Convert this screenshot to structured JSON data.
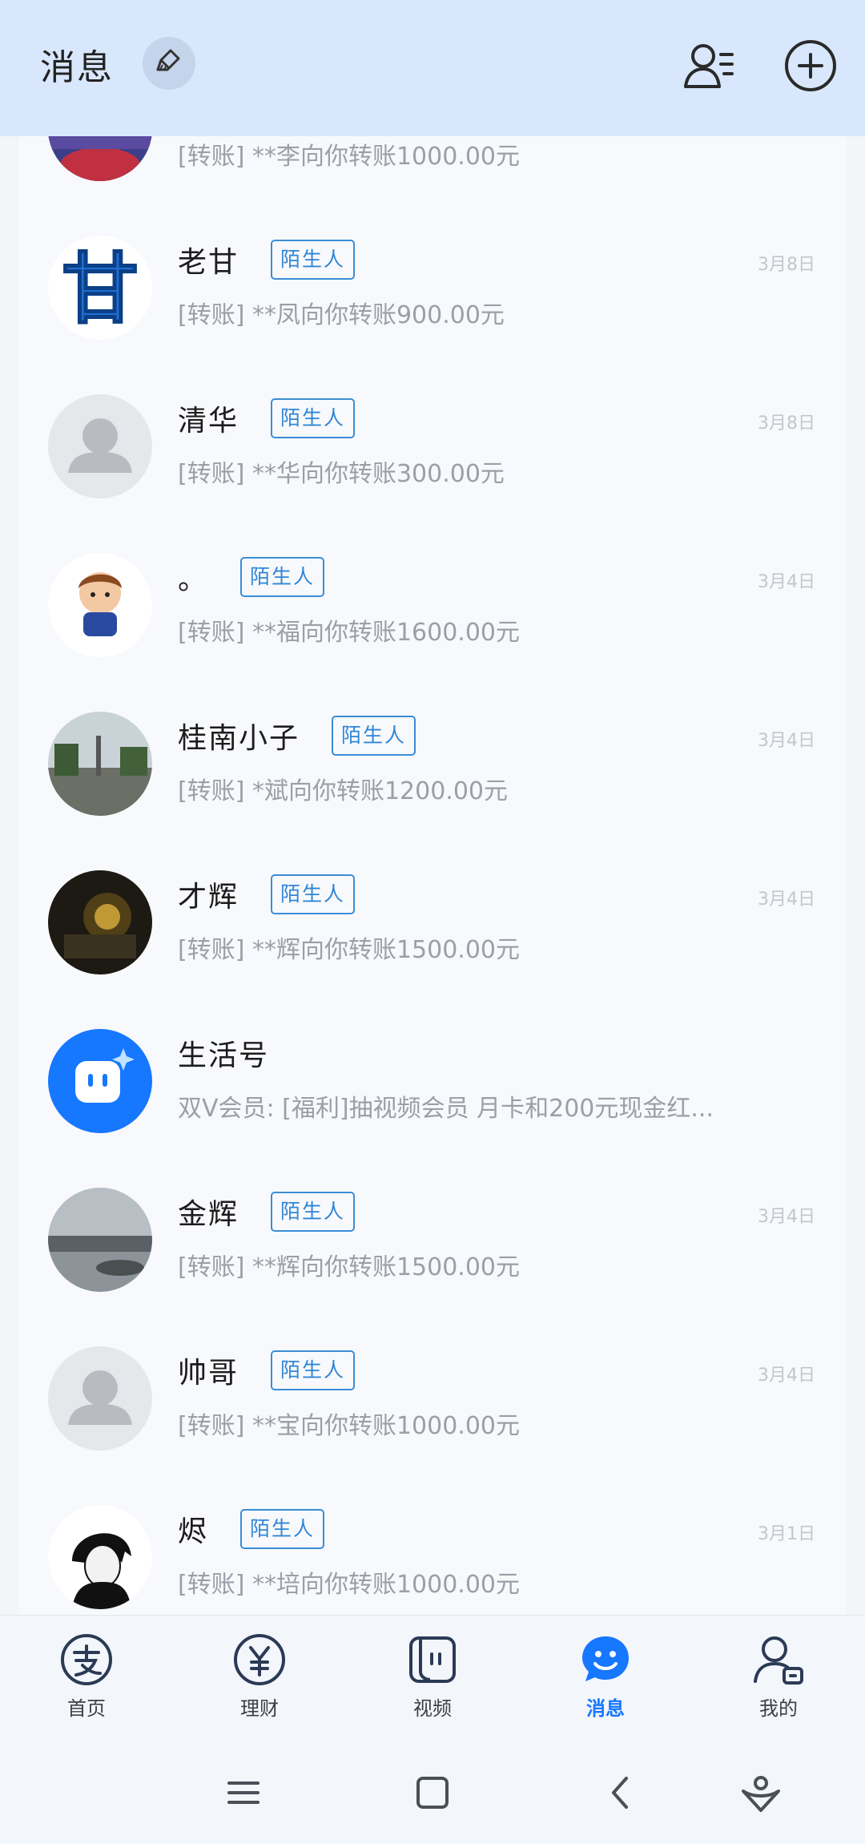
{
  "header": {
    "title": "消息"
  },
  "conversations": [
    {
      "name": "",
      "tag": "",
      "date": "",
      "preview": "[转账] **李向你转账1000.00元"
    },
    {
      "name": "老甘",
      "tag": "陌生人",
      "date": "3月8日",
      "preview": "[转账] **凤向你转账900.00元"
    },
    {
      "name": "清华",
      "tag": "陌生人",
      "date": "3月8日",
      "preview": "[转账] **华向你转账300.00元"
    },
    {
      "name": "。",
      "tag": "陌生人",
      "date": "3月4日",
      "preview": "[转账] **福向你转账1600.00元"
    },
    {
      "name": "桂南小子",
      "tag": "陌生人",
      "date": "3月4日",
      "preview": "[转账] *斌向你转账1200.00元"
    },
    {
      "name": "才辉",
      "tag": "陌生人",
      "date": "3月4日",
      "preview": "[转账] **辉向你转账1500.00元"
    },
    {
      "name": "生活号",
      "tag": "",
      "date": "",
      "preview": "双V会员: [福利]抽视频会员 月卡和200元现金红..."
    },
    {
      "name": "金辉",
      "tag": "陌生人",
      "date": "3月4日",
      "preview": "[转账] **辉向你转账1500.00元"
    },
    {
      "name": "帅哥",
      "tag": "陌生人",
      "date": "3月4日",
      "preview": "[转账] **宝向你转账1000.00元"
    },
    {
      "name": "烬",
      "tag": "陌生人",
      "date": "3月1日",
      "preview": "[转账] **培向你转账1000.00元"
    }
  ],
  "tabs": [
    {
      "label": "首页",
      "icon": "alipay-home-icon"
    },
    {
      "label": "理财",
      "icon": "yuan-icon"
    },
    {
      "label": "视频",
      "icon": "video-icon"
    },
    {
      "label": "消息",
      "icon": "message-icon",
      "active": true
    },
    {
      "label": "我的",
      "icon": "profile-icon"
    }
  ],
  "colors": {
    "header_bg": "#d8e7fb",
    "accent": "#1677ff",
    "tag": "#2f86d6"
  }
}
